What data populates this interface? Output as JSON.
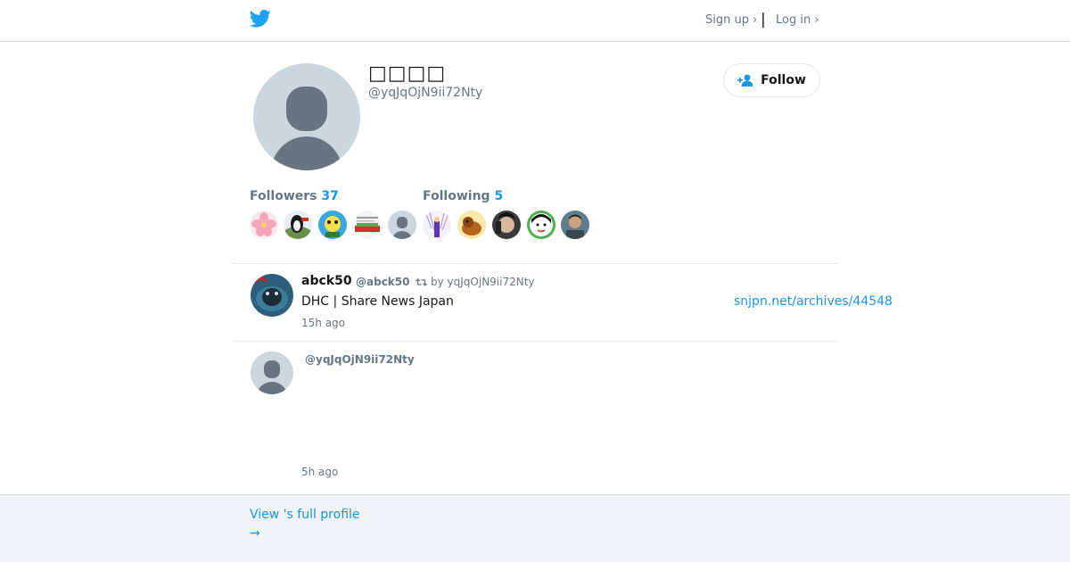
{
  "nav": {
    "signup_label": "Sign up ›",
    "separator": "|",
    "login_label": "Log in ›"
  },
  "profile": {
    "display_name": "□□□□",
    "screen_name": "@yqJqOjN9ii72Nty",
    "follow_label": "Follow"
  },
  "stats": {
    "followers_label": "Followers",
    "followers_count": "37",
    "following_label": "Following",
    "following_count": "5"
  },
  "tweets": [
    {
      "name": "abck50",
      "handle": "@abck50",
      "retweet_by": "by yqJqOjN9ii72Nty",
      "text": "DHC | Share News Japan",
      "link": "snjpn.net/archives/44548",
      "time": "15h ago"
    },
    {
      "handle_prefix": "@",
      "handle": "yqJqOjN9ii72Nty",
      "time": "5h ago"
    }
  ],
  "footer": {
    "link_line1": "View 's full profile",
    "link_line2": "→"
  },
  "colors": {
    "accent": "#1b95e0",
    "muted": "#657786",
    "footer_bg": "#f0f4f7"
  }
}
